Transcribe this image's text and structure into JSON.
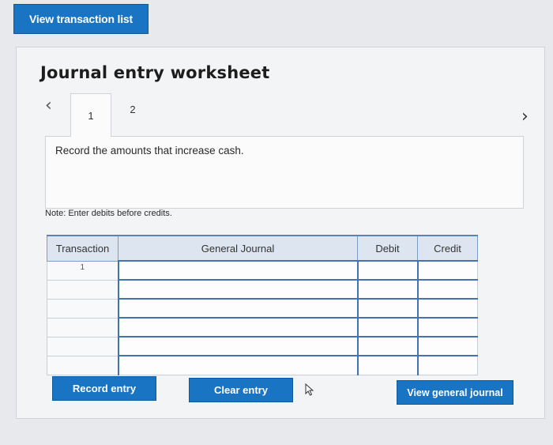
{
  "top_button": {
    "label": "View transaction list"
  },
  "worksheet": {
    "title": "Journal entry worksheet",
    "tabs": [
      "1",
      "2"
    ],
    "description": "Record the amounts that increase cash.",
    "note": "Note: Enter debits before credits."
  },
  "table": {
    "headers": {
      "transaction": "Transaction",
      "journal": "General Journal",
      "debit": "Debit",
      "credit": "Credit"
    },
    "rows": [
      {
        "transaction": "1"
      },
      {
        "transaction": ""
      },
      {
        "transaction": ""
      },
      {
        "transaction": ""
      },
      {
        "transaction": ""
      },
      {
        "transaction": ""
      }
    ]
  },
  "buttons": {
    "record": "Record entry",
    "clear": "Clear entry",
    "view_general": "View general journal"
  },
  "colors": {
    "accent": "#1a74c4",
    "header_bg": "#dde6f0",
    "input_border": "#3f73b6"
  }
}
